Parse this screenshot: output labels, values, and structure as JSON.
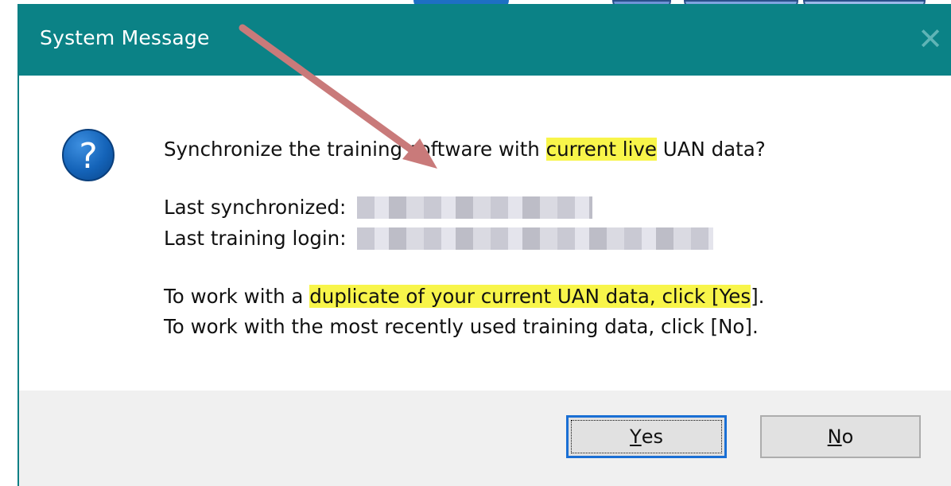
{
  "dialog": {
    "title": "System Message",
    "close_glyph": "✕",
    "icon": "question-icon",
    "message": {
      "line1_pre": "Synchronize the training software with ",
      "line1_highlight": "current live",
      "line1_post": " UAN data?",
      "last_synced_label": "Last synchronized:",
      "last_login_label": "Last training login:",
      "yes_pre": "To work with a ",
      "yes_highlight": "duplicate of your current UAN data, click [Yes",
      "yes_post": "].",
      "no_line": "To work with the most recently used training data, click [No]."
    },
    "buttons": {
      "yes_access": "Y",
      "yes_rest": "es",
      "no_access": "N",
      "no_rest": "o"
    }
  },
  "colors": {
    "titlebar": "#0b8286",
    "highlight": "#f8f54a",
    "arrow": "#c97a7a",
    "focus": "#1a6fd4"
  }
}
